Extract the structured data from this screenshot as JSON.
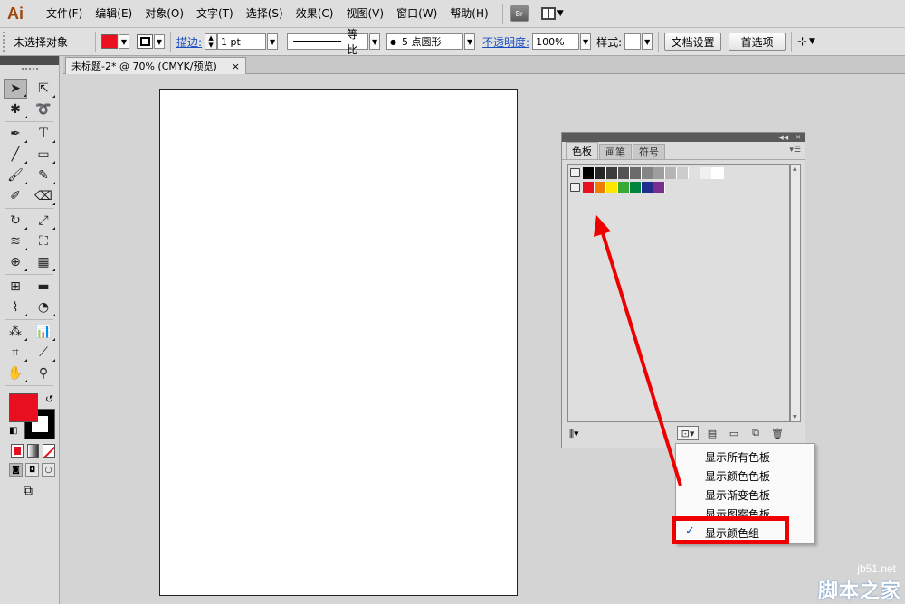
{
  "app": {
    "logo": "Ai"
  },
  "menu": [
    "文件(F)",
    "编辑(E)",
    "对象(O)",
    "文字(T)",
    "选择(S)",
    "效果(C)",
    "视图(V)",
    "窗口(W)",
    "帮助(H)"
  ],
  "menu_extra": {
    "bridge": "Br"
  },
  "control": {
    "selection_status": "未选择对象",
    "stroke_label": "描边:",
    "stroke_weight": "1 pt",
    "profile": "等比",
    "brush": "5 点圆形",
    "opacity_label": "不透明度:",
    "opacity_value": "100%",
    "style_label": "样式:",
    "doc_setup_button": "文档设置",
    "prefs_button": "首选项"
  },
  "document_tab": {
    "title": "未标题-2* @ 70% (CMYK/预览)",
    "close": "×"
  },
  "swatches_panel": {
    "tabs": [
      "色板",
      "画笔",
      "符号"
    ],
    "grays": [
      "#000000",
      "#262626",
      "#3d3d3d",
      "#545454",
      "#6b6b6b",
      "#858585",
      "#9e9e9e",
      "#b5b5b5",
      "#cccccc",
      "#e0e0e0",
      "#f0f0f0",
      "#ffffff"
    ],
    "colors": [
      "#e8101f",
      "#f07d00",
      "#ffe600",
      "#38a935",
      "#00833f",
      "#1d2e8c",
      "#7b2e8e"
    ]
  },
  "swatch_menu": {
    "items": [
      "显示所有色板",
      "显示颜色色板",
      "显示渐变色板",
      "显示图案色板",
      "显示颜色组"
    ],
    "checked_index": 4,
    "check": "✓"
  },
  "colors": {
    "fill": "#e8101f",
    "annotation": "#ee0000"
  },
  "watermark": {
    "line1": "jb51.net",
    "line2": "脚本之家"
  }
}
